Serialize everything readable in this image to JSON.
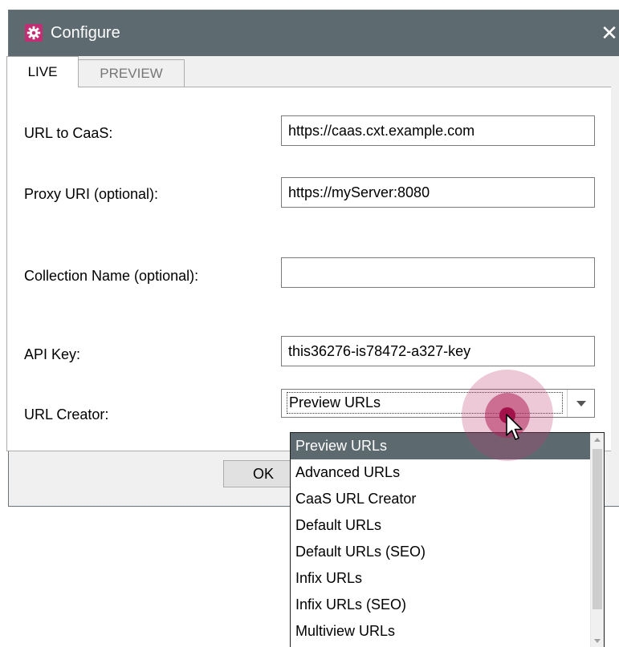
{
  "window": {
    "title": "Configure",
    "close_glyph": "✕",
    "app_icon": "gear-icon",
    "accent_color": "#c22d74",
    "titlebar_color": "#5d6a70"
  },
  "tabs": [
    {
      "label": "LIVE",
      "active": true
    },
    {
      "label": "PREVIEW",
      "active": false
    }
  ],
  "form": {
    "url_label": "URL to CaaS:",
    "url_value": "https://caas.cxt.example.com",
    "proxy_label": "Proxy URI (optional):",
    "proxy_value": "https://myServer:8080",
    "collection_label": "Collection Name (optional):",
    "collection_value": "",
    "apikey_label": "API Key:",
    "apikey_value": "this36276-is78472-a327-key",
    "creator_label": "URL Creator:",
    "creator_value": "Preview URLs"
  },
  "buttons": {
    "ok": "OK"
  },
  "dropdown": {
    "items": [
      "Preview URLs",
      "Advanced URLs",
      "CaaS URL Creator",
      "Default URLs",
      "Default URLs (SEO)",
      "Infix URLs",
      "Infix URLs (SEO)",
      "Multiview URLs"
    ],
    "selected_index": 0,
    "highlight_color": "#5c6a70"
  }
}
